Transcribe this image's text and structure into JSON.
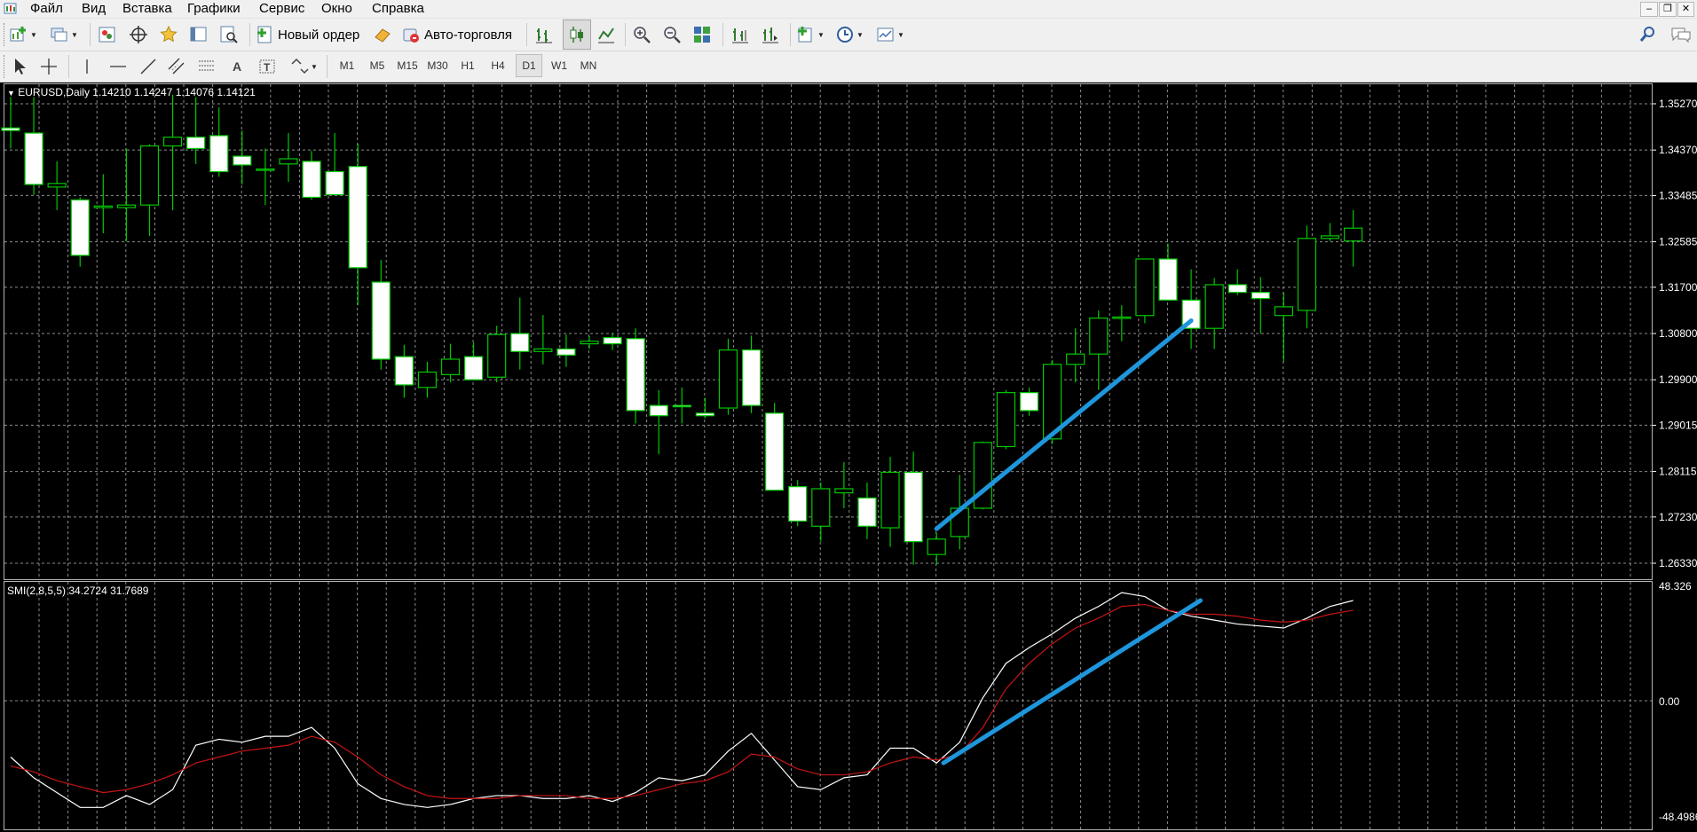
{
  "menu": {
    "items": [
      "Файл",
      "Вид",
      "Вставка",
      "Графики",
      "Сервис",
      "Окно",
      "Справка"
    ]
  },
  "toolbar": {
    "new_order_label": "Новый ордер",
    "autotrading_label": "Авто-торговля"
  },
  "timeframes": [
    "M1",
    "M5",
    "M15",
    "M30",
    "H1",
    "H4",
    "D1",
    "W1",
    "MN"
  ],
  "active_timeframe": "D1",
  "main_chart": {
    "symbol_label": "EURUSD,Daily",
    "ohlc": "1.14210 1.14247 1.14076 1.14121",
    "price_ticks": [
      "1.35270",
      "1.34370",
      "1.33485",
      "1.32585",
      "1.31700",
      "1.30800",
      "1.29900",
      "1.29015",
      "1.28115",
      "1.27230",
      "1.26330"
    ],
    "colors": {
      "background": "#000000",
      "bull_body": "#000000",
      "bear_body": "#ffffff",
      "wick": "#00c800",
      "grid": "#8c8c8c",
      "trendline": "#1e96dc"
    }
  },
  "indicator": {
    "label": "SMI(2,8,5,5)",
    "values": "34.2724 31.7689",
    "axis_ticks": [
      "48.326",
      "0.00",
      "-48.4986"
    ],
    "colors": {
      "main": "#ffffff",
      "signal": "#c81414"
    }
  },
  "chart_data": [
    {
      "type": "candlestick",
      "title": "EURUSD,Daily",
      "ylim": [
        1.2615,
        1.3617
      ],
      "candles": [
        [
          1.348,
          1.354,
          1.344,
          1.3475
        ],
        [
          1.347,
          1.354,
          1.335,
          1.337
        ],
        [
          1.3365,
          1.3415,
          1.332,
          1.3372
        ],
        [
          1.334,
          1.3345,
          1.321,
          1.3232
        ],
        [
          1.3325,
          1.339,
          1.3275,
          1.3328
        ],
        [
          1.3325,
          1.344,
          1.326,
          1.333
        ],
        [
          1.333,
          1.3448,
          1.327,
          1.3445
        ],
        [
          1.3445,
          1.3545,
          1.332,
          1.3462
        ],
        [
          1.3462,
          1.354,
          1.341,
          1.344
        ],
        [
          1.3465,
          1.352,
          1.3385,
          1.3395
        ],
        [
          1.3425,
          1.3475,
          1.337,
          1.3408
        ],
        [
          1.34,
          1.344,
          1.333,
          1.34
        ],
        [
          1.341,
          1.347,
          1.3375,
          1.342
        ],
        [
          1.3415,
          1.3435,
          1.334,
          1.3345
        ],
        [
          1.3395,
          1.347,
          1.336,
          1.335
        ],
        [
          1.3405,
          1.345,
          1.3135,
          1.3208
        ],
        [
          1.318,
          1.3223,
          1.301,
          1.303
        ],
        [
          1.3035,
          1.3058,
          1.2955,
          1.298
        ],
        [
          1.2975,
          1.3025,
          1.2955,
          1.3005
        ],
        [
          1.3,
          1.306,
          1.2985,
          1.303
        ],
        [
          1.3035,
          1.3063,
          1.2995,
          1.299
        ],
        [
          1.2995,
          1.3095,
          1.2985,
          1.3078
        ],
        [
          1.308,
          1.315,
          1.301,
          1.3045
        ],
        [
          1.3045,
          1.3116,
          1.302,
          1.305
        ],
        [
          1.305,
          1.3078,
          1.3015,
          1.3038
        ],
        [
          1.306,
          1.3075,
          1.305,
          1.3065
        ],
        [
          1.3072,
          1.308,
          1.3048,
          1.306
        ],
        [
          1.307,
          1.309,
          1.2905,
          1.293
        ],
        [
          1.294,
          1.297,
          1.2845,
          1.292
        ],
        [
          1.294,
          1.2975,
          1.2905,
          1.2938
        ],
        [
          1.2925,
          1.2955,
          1.2915,
          1.292
        ],
        [
          1.2935,
          1.307,
          1.2922,
          1.3048
        ],
        [
          1.3048,
          1.3076,
          1.2925,
          1.294
        ],
        [
          1.2925,
          1.2945,
          1.28,
          1.2775
        ],
        [
          1.2782,
          1.2795,
          1.2705,
          1.2715
        ],
        [
          1.2705,
          1.279,
          1.2675,
          1.2778
        ],
        [
          1.277,
          1.283,
          1.274,
          1.2778
        ],
        [
          1.276,
          1.279,
          1.268,
          1.2705
        ],
        [
          1.2702,
          1.284,
          1.2665,
          1.281
        ],
        [
          1.281,
          1.285,
          1.263,
          1.2675
        ],
        [
          1.265,
          1.2692,
          1.263,
          1.268
        ],
        [
          1.2685,
          1.2805,
          1.266,
          1.274
        ],
        [
          1.274,
          1.287,
          1.2738,
          1.2868
        ],
        [
          1.286,
          1.297,
          1.2855,
          1.2965
        ],
        [
          1.2965,
          1.2975,
          1.292,
          1.293
        ],
        [
          1.2875,
          1.3028,
          1.2865,
          1.302
        ],
        [
          1.302,
          1.309,
          1.2985,
          1.304
        ],
        [
          1.304,
          1.3125,
          1.297,
          1.311
        ],
        [
          1.311,
          1.3135,
          1.3065,
          1.3112
        ],
        [
          1.3115,
          1.3225,
          1.31,
          1.3225
        ],
        [
          1.3225,
          1.3255,
          1.3145,
          1.3145
        ],
        [
          1.3145,
          1.3205,
          1.305,
          1.309
        ],
        [
          1.309,
          1.3188,
          1.305,
          1.3175
        ],
        [
          1.3175,
          1.3205,
          1.3155,
          1.316
        ],
        [
          1.316,
          1.319,
          1.308,
          1.3148
        ],
        [
          1.3115,
          1.316,
          1.3025,
          1.3132
        ],
        [
          1.3125,
          1.329,
          1.309,
          1.3265
        ],
        [
          1.3265,
          1.3295,
          1.326,
          1.327
        ],
        [
          1.326,
          1.332,
          1.321,
          1.3285
        ]
      ],
      "trendline": [
        [
          40,
          1.27
        ],
        [
          51,
          1.3105
        ]
      ]
    },
    {
      "type": "line",
      "title": "SMI(2,8,5,5)",
      "ylim": [
        -48.4986,
        48.326
      ],
      "series": [
        {
          "name": "main",
          "values": [
            -25,
            -32,
            -37,
            -42,
            -42,
            -38,
            -41,
            -36,
            -21,
            -19,
            -20,
            -18,
            -18,
            -15,
            -22,
            -34,
            -39,
            -41,
            -42,
            -41,
            -39,
            -38,
            -38,
            -39,
            -39,
            -38,
            -40,
            -37,
            -32,
            -33,
            -31,
            -23,
            -17,
            -26,
            -35,
            -36,
            -32,
            -31,
            -22,
            -22,
            -27,
            -20,
            -5,
            10,
            18,
            25,
            33,
            39,
            46,
            44,
            37,
            34,
            32,
            30,
            29,
            28,
            33,
            39,
            42
          ]
        },
        {
          "name": "signal",
          "values": [
            -28,
            -30,
            -33,
            -35,
            -37,
            -36,
            -34,
            -31,
            -27,
            -25,
            -23,
            -22,
            -21,
            -18,
            -20,
            -25,
            -31,
            -35,
            -38,
            -39,
            -39,
            -39,
            -38,
            -38,
            -38,
            -39,
            -39,
            -38,
            -36,
            -34,
            -33,
            -30,
            -24,
            -25,
            -29,
            -31,
            -31,
            -30,
            -27,
            -25,
            -26,
            -24,
            -15,
            -2,
            10,
            20,
            28,
            33,
            39,
            40,
            37,
            35,
            35,
            34,
            32,
            31,
            32,
            35,
            37
          ]
        }
      ],
      "trendline": [
        [
          40.3,
          -27
        ],
        [
          51.4,
          42
        ]
      ]
    }
  ]
}
